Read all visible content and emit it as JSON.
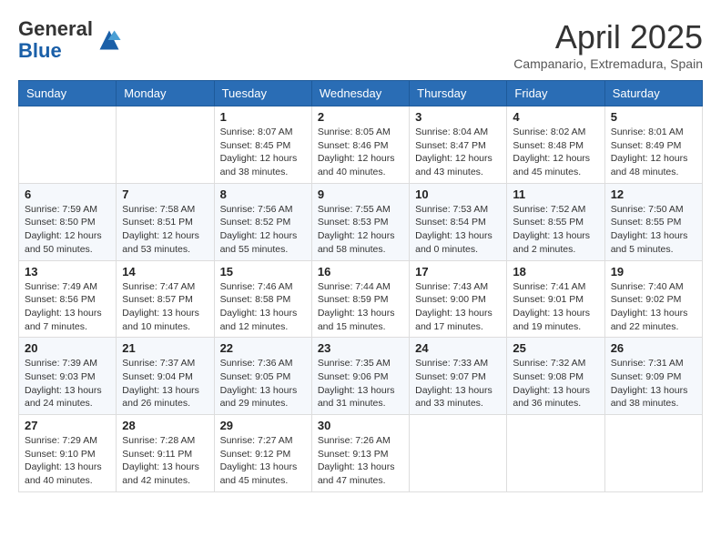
{
  "header": {
    "logo_general": "General",
    "logo_blue": "Blue",
    "month_title": "April 2025",
    "subtitle": "Campanario, Extremadura, Spain"
  },
  "days_of_week": [
    "Sunday",
    "Monday",
    "Tuesday",
    "Wednesday",
    "Thursday",
    "Friday",
    "Saturday"
  ],
  "weeks": [
    [
      {
        "day": "",
        "info": ""
      },
      {
        "day": "",
        "info": ""
      },
      {
        "day": "1",
        "info": "Sunrise: 8:07 AM\nSunset: 8:45 PM\nDaylight: 12 hours and 38 minutes."
      },
      {
        "day": "2",
        "info": "Sunrise: 8:05 AM\nSunset: 8:46 PM\nDaylight: 12 hours and 40 minutes."
      },
      {
        "day": "3",
        "info": "Sunrise: 8:04 AM\nSunset: 8:47 PM\nDaylight: 12 hours and 43 minutes."
      },
      {
        "day": "4",
        "info": "Sunrise: 8:02 AM\nSunset: 8:48 PM\nDaylight: 12 hours and 45 minutes."
      },
      {
        "day": "5",
        "info": "Sunrise: 8:01 AM\nSunset: 8:49 PM\nDaylight: 12 hours and 48 minutes."
      }
    ],
    [
      {
        "day": "6",
        "info": "Sunrise: 7:59 AM\nSunset: 8:50 PM\nDaylight: 12 hours and 50 minutes."
      },
      {
        "day": "7",
        "info": "Sunrise: 7:58 AM\nSunset: 8:51 PM\nDaylight: 12 hours and 53 minutes."
      },
      {
        "day": "8",
        "info": "Sunrise: 7:56 AM\nSunset: 8:52 PM\nDaylight: 12 hours and 55 minutes."
      },
      {
        "day": "9",
        "info": "Sunrise: 7:55 AM\nSunset: 8:53 PM\nDaylight: 12 hours and 58 minutes."
      },
      {
        "day": "10",
        "info": "Sunrise: 7:53 AM\nSunset: 8:54 PM\nDaylight: 13 hours and 0 minutes."
      },
      {
        "day": "11",
        "info": "Sunrise: 7:52 AM\nSunset: 8:55 PM\nDaylight: 13 hours and 2 minutes."
      },
      {
        "day": "12",
        "info": "Sunrise: 7:50 AM\nSunset: 8:55 PM\nDaylight: 13 hours and 5 minutes."
      }
    ],
    [
      {
        "day": "13",
        "info": "Sunrise: 7:49 AM\nSunset: 8:56 PM\nDaylight: 13 hours and 7 minutes."
      },
      {
        "day": "14",
        "info": "Sunrise: 7:47 AM\nSunset: 8:57 PM\nDaylight: 13 hours and 10 minutes."
      },
      {
        "day": "15",
        "info": "Sunrise: 7:46 AM\nSunset: 8:58 PM\nDaylight: 13 hours and 12 minutes."
      },
      {
        "day": "16",
        "info": "Sunrise: 7:44 AM\nSunset: 8:59 PM\nDaylight: 13 hours and 15 minutes."
      },
      {
        "day": "17",
        "info": "Sunrise: 7:43 AM\nSunset: 9:00 PM\nDaylight: 13 hours and 17 minutes."
      },
      {
        "day": "18",
        "info": "Sunrise: 7:41 AM\nSunset: 9:01 PM\nDaylight: 13 hours and 19 minutes."
      },
      {
        "day": "19",
        "info": "Sunrise: 7:40 AM\nSunset: 9:02 PM\nDaylight: 13 hours and 22 minutes."
      }
    ],
    [
      {
        "day": "20",
        "info": "Sunrise: 7:39 AM\nSunset: 9:03 PM\nDaylight: 13 hours and 24 minutes."
      },
      {
        "day": "21",
        "info": "Sunrise: 7:37 AM\nSunset: 9:04 PM\nDaylight: 13 hours and 26 minutes."
      },
      {
        "day": "22",
        "info": "Sunrise: 7:36 AM\nSunset: 9:05 PM\nDaylight: 13 hours and 29 minutes."
      },
      {
        "day": "23",
        "info": "Sunrise: 7:35 AM\nSunset: 9:06 PM\nDaylight: 13 hours and 31 minutes."
      },
      {
        "day": "24",
        "info": "Sunrise: 7:33 AM\nSunset: 9:07 PM\nDaylight: 13 hours and 33 minutes."
      },
      {
        "day": "25",
        "info": "Sunrise: 7:32 AM\nSunset: 9:08 PM\nDaylight: 13 hours and 36 minutes."
      },
      {
        "day": "26",
        "info": "Sunrise: 7:31 AM\nSunset: 9:09 PM\nDaylight: 13 hours and 38 minutes."
      }
    ],
    [
      {
        "day": "27",
        "info": "Sunrise: 7:29 AM\nSunset: 9:10 PM\nDaylight: 13 hours and 40 minutes."
      },
      {
        "day": "28",
        "info": "Sunrise: 7:28 AM\nSunset: 9:11 PM\nDaylight: 13 hours and 42 minutes."
      },
      {
        "day": "29",
        "info": "Sunrise: 7:27 AM\nSunset: 9:12 PM\nDaylight: 13 hours and 45 minutes."
      },
      {
        "day": "30",
        "info": "Sunrise: 7:26 AM\nSunset: 9:13 PM\nDaylight: 13 hours and 47 minutes."
      },
      {
        "day": "",
        "info": ""
      },
      {
        "day": "",
        "info": ""
      },
      {
        "day": "",
        "info": ""
      }
    ]
  ]
}
